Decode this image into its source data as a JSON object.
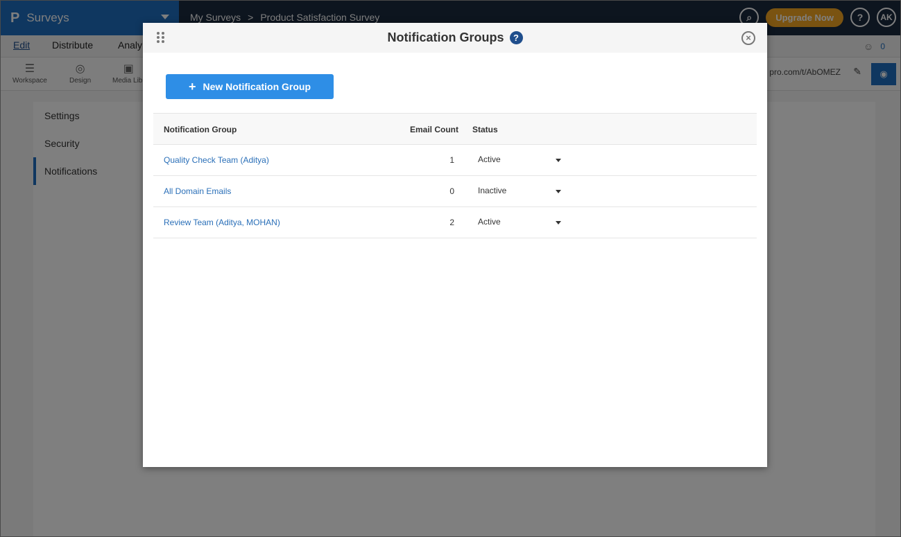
{
  "header": {
    "brand_logo": "P",
    "brand_name": "Surveys",
    "breadcrumb": [
      "My Surveys",
      ">",
      "Product Satisfaction Survey"
    ],
    "upgrade_label": "Upgrade Now",
    "help_label": "?",
    "avatar_initials": "AK"
  },
  "menubar": {
    "items": [
      "Edit",
      "Distribute",
      "Analy"
    ],
    "people_count": "0"
  },
  "toolbar": {
    "tools": [
      "Workspace",
      "Design",
      "Media Libr"
    ],
    "url_fragment": "pro.com/t/AbOMEZ"
  },
  "leftnav": {
    "items": [
      "Settings",
      "Security",
      "Notifications"
    ]
  },
  "modal": {
    "title": "Notification Groups",
    "help_icon": "?",
    "close_icon": "×",
    "new_button_label": "New Notification Group",
    "columns": {
      "group": "Notification Group",
      "count": "Email Count",
      "status": "Status"
    },
    "rows": [
      {
        "name": "Quality Check Team (Aditya)",
        "count": "1",
        "status": "Active"
      },
      {
        "name": "All Domain Emails",
        "count": "0",
        "status": "Inactive"
      },
      {
        "name": "Review Team (Aditya, MOHAN)",
        "count": "2",
        "status": "Active"
      }
    ]
  },
  "colors": {
    "brand_blue": "#1f6fc0",
    "header_dark": "#1b2a3f",
    "button_blue": "#2e8ee6",
    "upgrade_orange": "#f5a623",
    "link_blue": "#2a6fb8"
  }
}
